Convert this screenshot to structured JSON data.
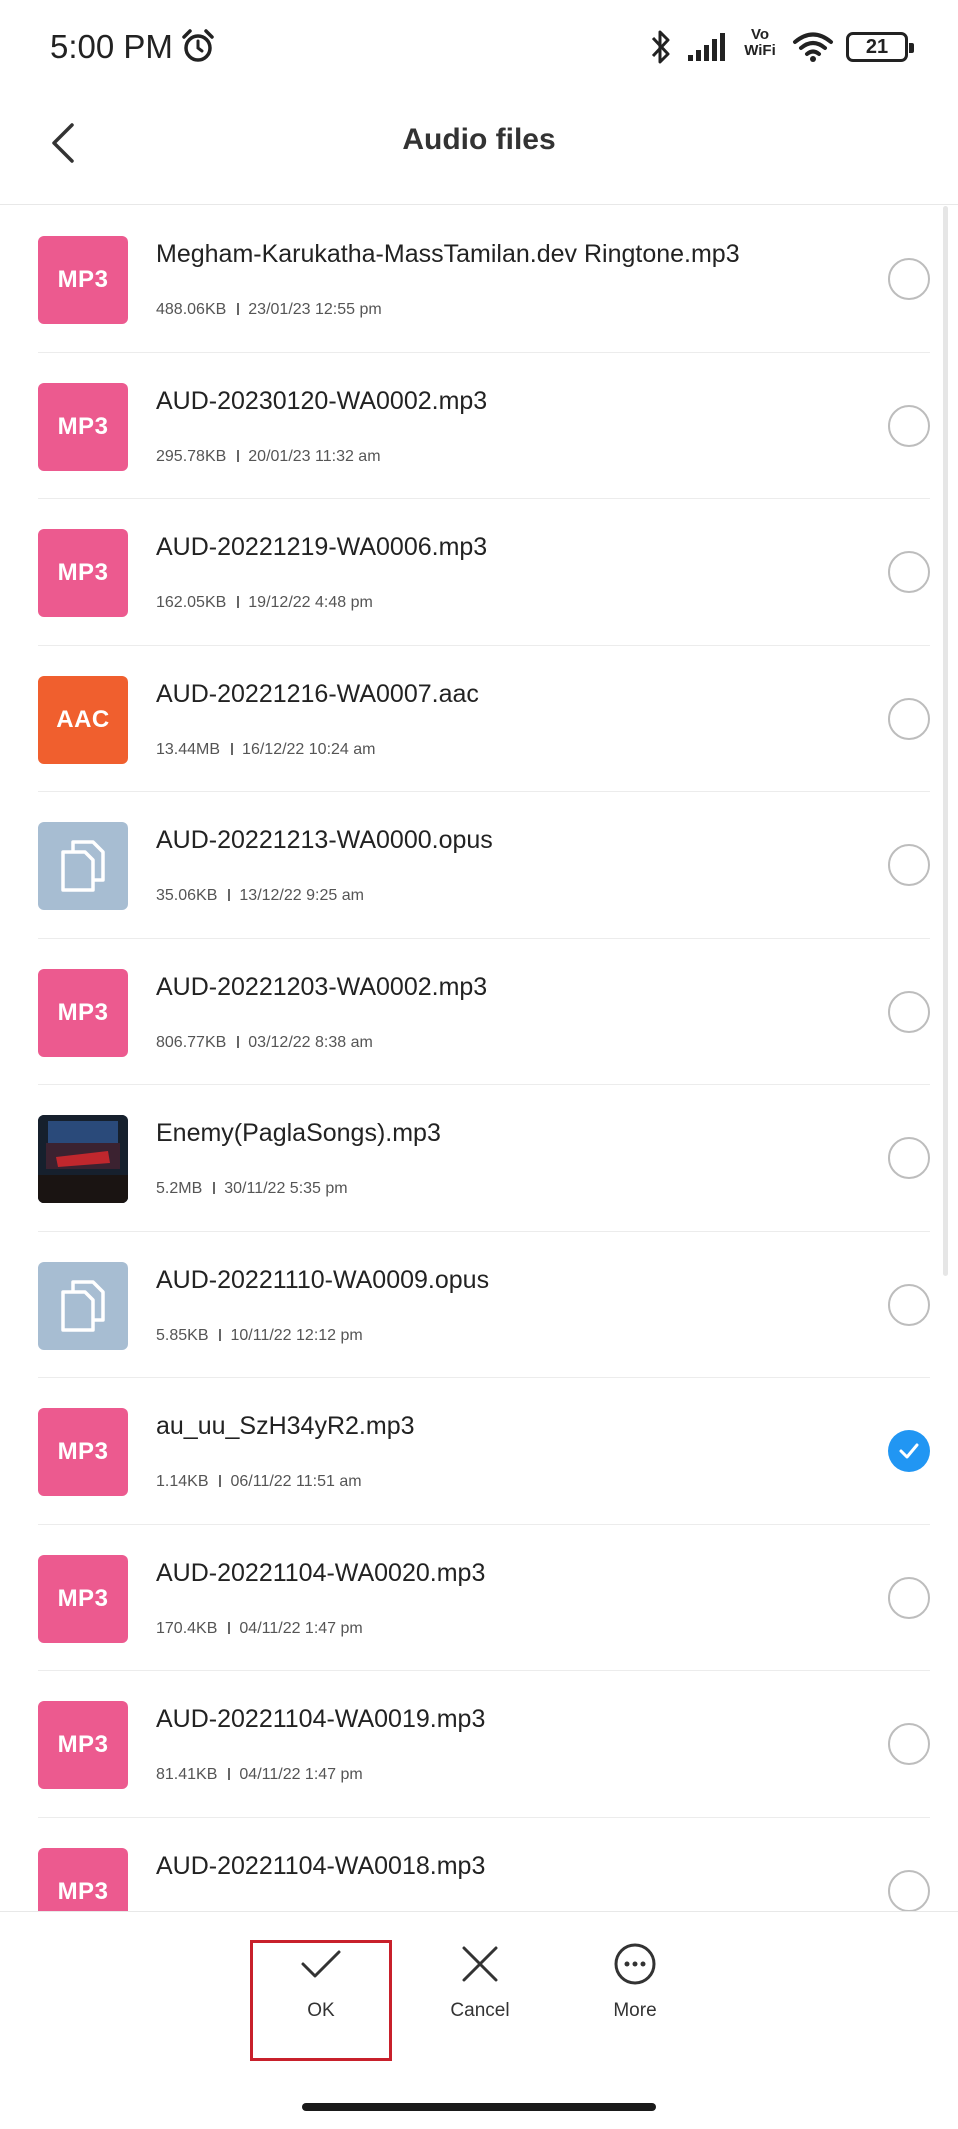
{
  "status_bar": {
    "time": "5:00 PM",
    "network_label_top": "Vo",
    "network_label_bottom": "WiFi",
    "battery": "21",
    "icons": [
      "alarm-icon",
      "bluetooth-icon",
      "signal-icon",
      "wifi-icon",
      "battery-icon"
    ]
  },
  "header": {
    "title": "Audio files",
    "back_icon": "chevron-left-icon"
  },
  "files": [
    {
      "name": "Megham-Karukatha-MassTamilan.dev Ringtone.mp3",
      "size": "488.06KB",
      "date": "23/01/23 12:55 pm",
      "type_label": "MP3",
      "thumb": "mp3",
      "selected": false
    },
    {
      "name": "AUD-20230120-WA0002.mp3",
      "size": "295.78KB",
      "date": "20/01/23 11:32 am",
      "type_label": "MP3",
      "thumb": "mp3",
      "selected": false
    },
    {
      "name": "AUD-20221219-WA0006.mp3",
      "size": "162.05KB",
      "date": "19/12/22 4:48 pm",
      "type_label": "MP3",
      "thumb": "mp3",
      "selected": false
    },
    {
      "name": "AUD-20221216-WA0007.aac",
      "size": "13.44MB",
      "date": "16/12/22 10:24 am",
      "type_label": "AAC",
      "thumb": "aac",
      "selected": false
    },
    {
      "name": "AUD-20221213-WA0000.opus",
      "size": "35.06KB",
      "date": "13/12/22 9:25 am",
      "type_label": "",
      "thumb": "doc",
      "selected": false
    },
    {
      "name": "AUD-20221203-WA0002.mp3",
      "size": "806.77KB",
      "date": "03/12/22 8:38 am",
      "type_label": "MP3",
      "thumb": "mp3",
      "selected": false
    },
    {
      "name": "Enemy(PaglaSongs).mp3",
      "size": "5.2MB",
      "date": "30/11/22 5:35 pm",
      "type_label": "",
      "thumb": "img",
      "selected": false
    },
    {
      "name": "AUD-20221110-WA0009.opus",
      "size": "5.85KB",
      "date": "10/11/22 12:12 pm",
      "type_label": "",
      "thumb": "doc",
      "selected": false
    },
    {
      "name": "au_uu_SzH34yR2.mp3",
      "size": "1.14KB",
      "date": "06/11/22 11:51 am",
      "type_label": "MP3",
      "thumb": "mp3",
      "selected": true
    },
    {
      "name": "AUD-20221104-WA0020.mp3",
      "size": "170.4KB",
      "date": "04/11/22 1:47 pm",
      "type_label": "MP3",
      "thumb": "mp3",
      "selected": false
    },
    {
      "name": "AUD-20221104-WA0019.mp3",
      "size": "81.41KB",
      "date": "04/11/22 1:47 pm",
      "type_label": "MP3",
      "thumb": "mp3",
      "selected": false
    },
    {
      "name": "AUD-20221104-WA0018.mp3",
      "size": "",
      "date": "",
      "type_label": "MP3",
      "thumb": "mp3",
      "selected": false
    }
  ],
  "actions": {
    "ok": {
      "label": "OK",
      "icon": "check-icon"
    },
    "cancel": {
      "label": "Cancel",
      "icon": "close-icon"
    },
    "more": {
      "label": "More",
      "icon": "more-icon"
    }
  },
  "colors": {
    "mp3": "#ec5a8f",
    "aac": "#f05f2e",
    "doc": "#a7bdd2",
    "selected": "#2196f3",
    "highlight": "#c8202b"
  }
}
